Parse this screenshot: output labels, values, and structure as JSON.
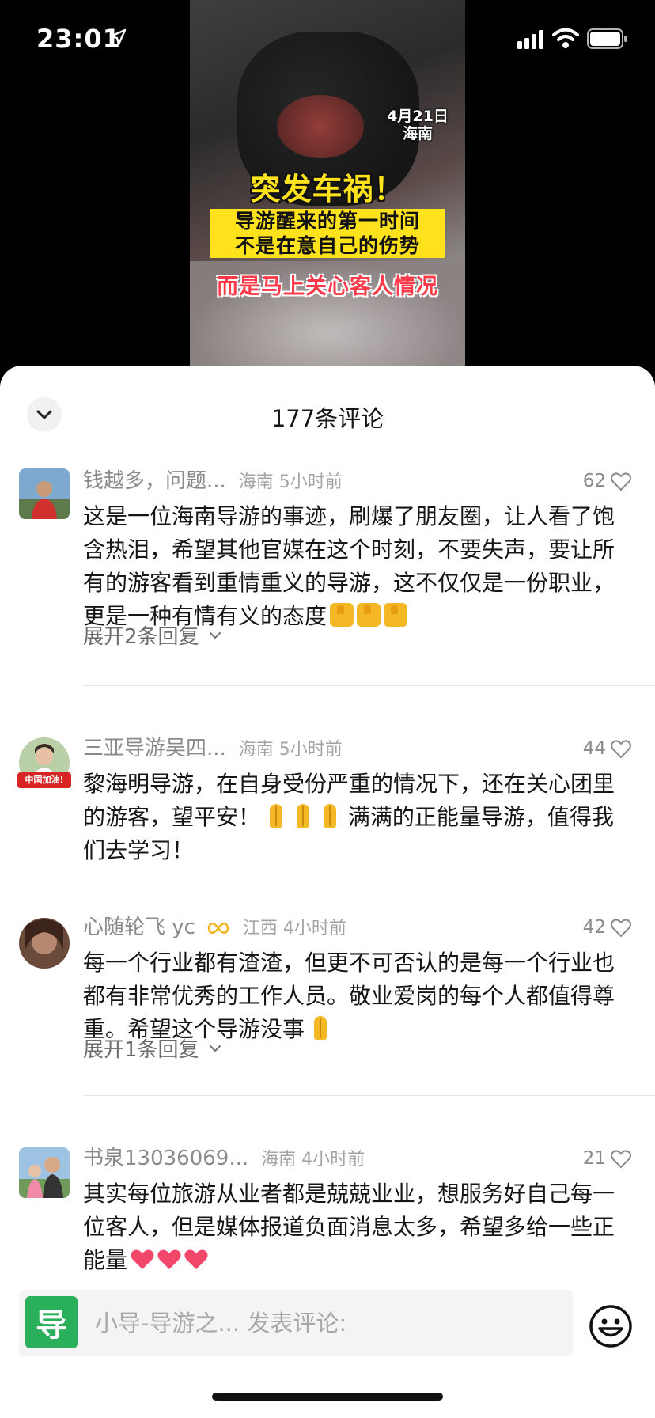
{
  "status": {
    "time": "23:01"
  },
  "video": {
    "date": "4月21日",
    "location": "海南",
    "headline": "突发车祸！",
    "line1": "导游醒来的第一时间",
    "line2": "不是在意自己的伤势",
    "line3": "而是马上关心客人情况"
  },
  "sheet": {
    "title": "177条评论"
  },
  "comments": [
    {
      "user": "钱越多，问题...",
      "meta": "海南 5小时前",
      "likes": "62",
      "body": "这是一位海南导游的事迹，刷爆了朋友圈，让人看了饱含热泪，希望其他官媒在这个时刻，不要失声，要让所有的游客看到重情重义的导游，这不仅仅是一份职业，更是一种有情有义的态度",
      "expand": "展开2条回复"
    },
    {
      "user": "三亚导游吴四...",
      "meta": "海南 5小时前",
      "likes": "44",
      "body_a": "黎海明导游，在自身受份严重的情况下，还在关心团里的游客，望平安！",
      "body_b": " 满满的正能量导游，值得我们去学习！",
      "avatar_badge": "中国加油!"
    },
    {
      "user": "心随轮飞 yc",
      "meta": "江西 4小时前",
      "likes": "42",
      "body": "每一个行业都有渣渣，但更不可否认的是每一个行业也都有非常优秀的工作人员。敬业爱岗的每个人都值得尊重。希望这个导游没事",
      "expand": "展开1条回复"
    },
    {
      "user": "书泉13036069...",
      "meta": "海南 4小时前",
      "likes": "21",
      "body": "其实每位旅游从业者都是兢兢业业，想服务好自己每一位客人，但是媒体报道负面消息太多，希望多给一些正能量"
    }
  ],
  "input": {
    "logo_char": "导",
    "placeholder": "小导-导游之... 发表评论:"
  },
  "colors": {
    "accent_green": "#2ab05a",
    "headline_yellow": "#ffe21b",
    "emphasis_red": "#ff3b4a"
  }
}
